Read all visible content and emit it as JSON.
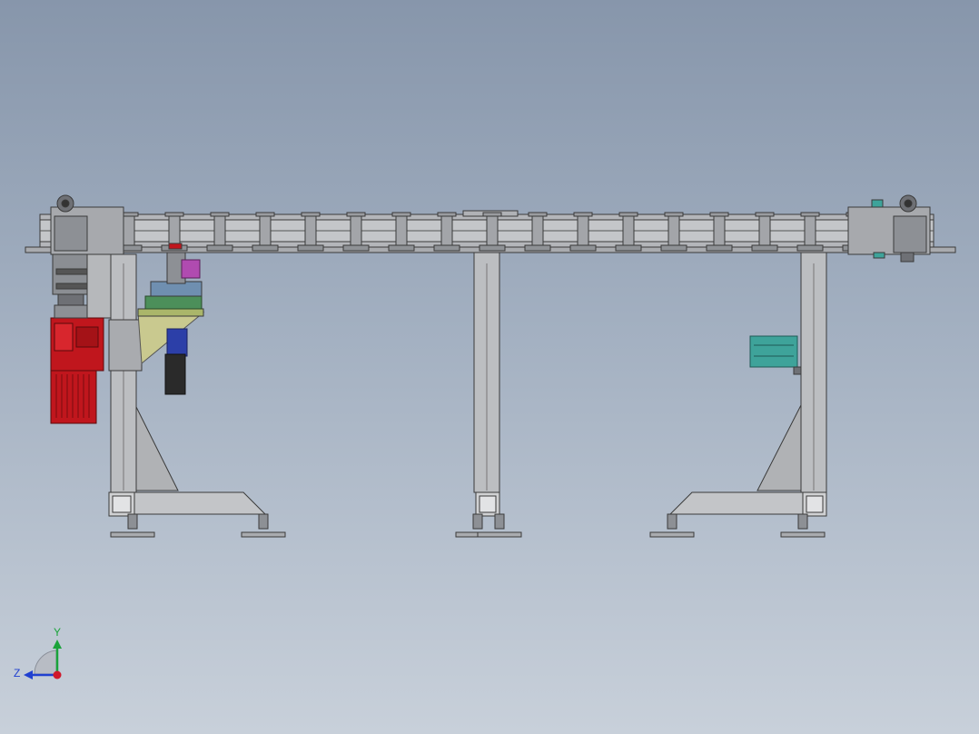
{
  "triad": {
    "y_label": "Y",
    "z_label": "Z",
    "x_color": "#d0182a",
    "y_color": "#1aa33a",
    "z_color": "#2040d0"
  },
  "colors": {
    "frame_fill": "#b9babd",
    "frame_line": "#3a3a3a",
    "motor": "#c0161d",
    "motor_dark": "#7a0c10",
    "bracket": "#c9c98f",
    "cylinder": "#2c3fa8",
    "pneumatic": "#2a2a2a",
    "purple": "#b04bb0",
    "teal": "#3ea39a",
    "green_plate": "#4c8f5a"
  },
  "model": {
    "chain_link_count": 18
  }
}
